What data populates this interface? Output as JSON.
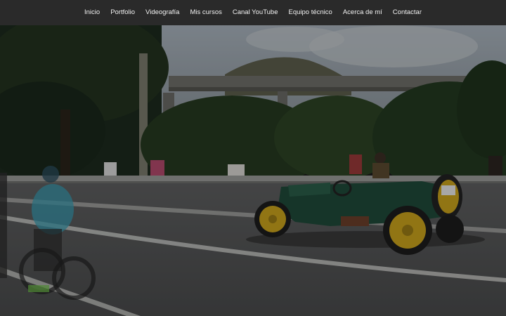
{
  "nav": {
    "items": [
      {
        "label": "Inicio"
      },
      {
        "label": "Portfolio"
      },
      {
        "label": "Videografía"
      },
      {
        "label": "Mis cursos"
      },
      {
        "label": "Canal YouTube"
      },
      {
        "label": "Equipo técnico"
      },
      {
        "label": "Acerca de mí"
      },
      {
        "label": "Contactar"
      }
    ]
  },
  "colors": {
    "nav_bg": "#2a2a2a",
    "car_green": "#1f4a3a",
    "wheel_yellow": "#c9a21c"
  }
}
